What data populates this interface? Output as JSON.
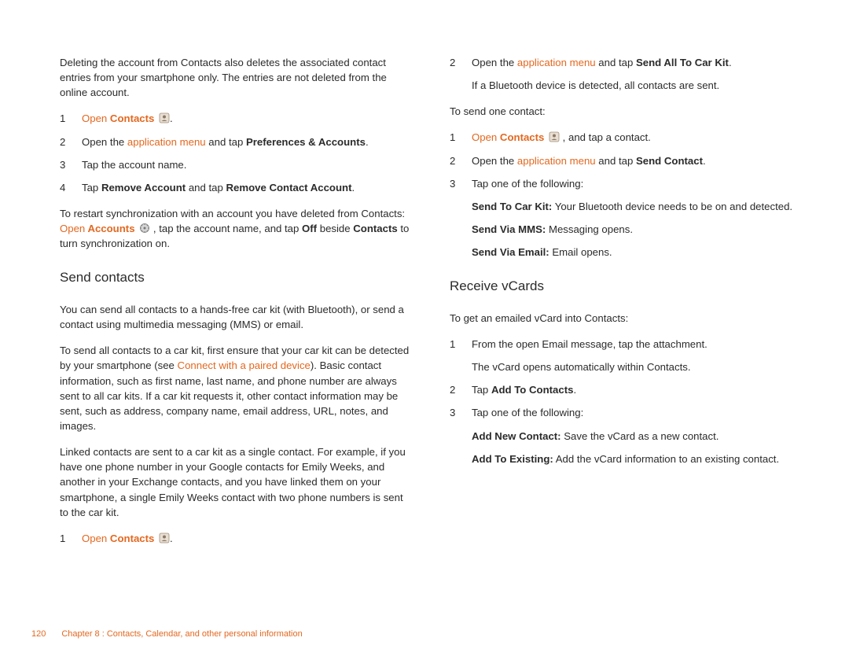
{
  "left": {
    "intro": "Deleting the account from Contacts also deletes the associated contact entries from your smartphone only. The entries are not deleted from the online account.",
    "step1_num": "1",
    "step1_open": "Open",
    "step1_contacts": " Contacts ",
    "step1_icon_title": "Contacts app icon",
    "step1_period": ".",
    "step2_num": "2",
    "step2_a": "Open the ",
    "step2_link": "application menu",
    "step2_b": " and tap ",
    "step2_bold": "Preferences & Accounts",
    "step2_c": ".",
    "step3_num": "3",
    "step3_text": "Tap the account name.",
    "step4_num": "4",
    "step4_a": "Tap ",
    "step4_b1": "Remove Account",
    "step4_mid": " and tap ",
    "step4_b2": "Remove Contact Account",
    "step4_c": ".",
    "restart_a": "To restart synchronization with an account you have deleted from Contacts: ",
    "restart_open": "Open",
    "restart_acc": " Accounts ",
    "restart_icon_title": "Accounts app icon",
    "restart_b": " , tap the account name, and tap ",
    "restart_off": "Off",
    "restart_c": " beside ",
    "restart_contacts": "Contacts",
    "restart_d": " to turn synchronization on.",
    "heading_send": "Send contacts",
    "send_p1": "You can send all contacts to a hands-free car kit (with Bluetooth), or send a contact using multimedia messaging (MMS) or email.",
    "send_p2_a": "To send all contacts to a car kit, first ensure that your car kit can be detected by your smartphone (see ",
    "send_p2_link": "Connect with a paired device",
    "send_p2_b": "). Basic contact information, such as first name, last name, and phone number are always sent to all car kits. If a car kit requests it, other contact information may be sent, such as address, company name, email address, URL, notes, and images.",
    "send_p3": "Linked contacts are sent to a car kit as a single contact. For example, if you have one phone number in your Google contacts for Emily Weeks, and another in your Exchange contacts, and you have linked them on your smartphone, a single Emily Weeks contact with two phone numbers is sent to the car kit.",
    "sendstep1_num": "1",
    "sendstep1_open": "Open",
    "sendstep1_contacts": " Contacts ",
    "sendstep1_period": "."
  },
  "right": {
    "r1_num": "2",
    "r1_a": "Open the ",
    "r1_link": "application menu",
    "r1_b": " and tap ",
    "r1_bold": "Send All To Car Kit",
    "r1_c": ".",
    "r_detect": "If a Bluetooth device is detected, all contacts are sent.",
    "r_sendone": "To send one contact:",
    "r2_num": "1",
    "r2_open": "Open",
    "r2_contacts": " Contacts ",
    "r2_tail": " , and tap a contact.",
    "r3_num": "2",
    "r3_a": "Open the ",
    "r3_link": "application menu",
    "r3_b": " and tap ",
    "r3_bold": "Send Contact",
    "r3_c": ".",
    "r4_num": "3",
    "r4_text": "Tap one of the following:",
    "opt1_b": "Send To Car Kit:",
    "opt1_t": " Your Bluetooth device needs to be on and detected.",
    "opt2_b": "Send Via MMS:",
    "opt2_t": " Messaging opens.",
    "opt3_b": "Send Via Email:",
    "opt3_t": " Email opens.",
    "heading_recv": "Receive vCards",
    "recv_intro": "To get an emailed vCard into Contacts:",
    "rv1_num": "1",
    "rv1_text": "From the open Email message, tap the attachment.",
    "rv1_sub": "The vCard opens automatically within Contacts.",
    "rv2_num": "2",
    "rv2_a": "Tap ",
    "rv2_bold": "Add To Contacts",
    "rv2_c": ".",
    "rv3_num": "3",
    "rv3_text": "Tap one of the following:",
    "rvopt1_b": "Add New Contact:",
    "rvopt1_t": " Save the vCard as a new contact.",
    "rvopt2_b": "Add To Existing:",
    "rvopt2_t": " Add the vCard information to an existing contact."
  },
  "footer": {
    "page": "120",
    "chapter": "Chapter 8 : Contacts, Calendar, and other personal information"
  }
}
